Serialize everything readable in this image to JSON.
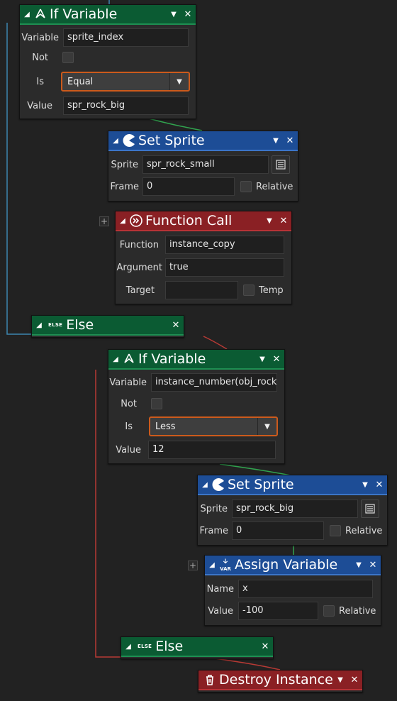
{
  "nodes": {
    "if_var_1": {
      "title": "If Variable",
      "variable_label": "Variable",
      "variable_value": "sprite_index",
      "not_label": "Not",
      "is_label": "Is",
      "is_value": "Equal",
      "value_label": "Value",
      "value_value": "spr_rock_big"
    },
    "set_sprite_1": {
      "title": "Set Sprite",
      "sprite_label": "Sprite",
      "sprite_value": "spr_rock_small",
      "frame_label": "Frame",
      "frame_value": "0",
      "relative_label": "Relative"
    },
    "function_call": {
      "title": "Function Call",
      "function_label": "Function",
      "function_value": "instance_copy",
      "argument_label": "Argument",
      "argument_value": "true",
      "target_label": "Target",
      "target_value": "",
      "temp_label": "Temp"
    },
    "else_1": {
      "tag": "ELSE",
      "title": "Else"
    },
    "if_var_2": {
      "title": "If Variable",
      "variable_label": "Variable",
      "variable_value": "instance_number(obj_rock)",
      "not_label": "Not",
      "is_label": "Is",
      "is_value": "Less",
      "value_label": "Value",
      "value_value": "12"
    },
    "set_sprite_2": {
      "title": "Set Sprite",
      "sprite_label": "Sprite",
      "sprite_value": "spr_rock_big",
      "frame_label": "Frame",
      "frame_value": "0",
      "relative_label": "Relative"
    },
    "assign_var": {
      "icon_text": "VAR",
      "title": "Assign Variable",
      "name_label": "Name",
      "name_value": "x",
      "value_label": "Value",
      "value_value": "-100",
      "relative_label": "Relative"
    },
    "else_2": {
      "tag": "ELSE",
      "title": "Else"
    },
    "destroy": {
      "title": "Destroy Instance"
    }
  },
  "glyphs": {
    "collapse": "◢",
    "dropdown": "▼",
    "close": "✕",
    "plus": "+"
  },
  "colors": {
    "green_header": "#0b5b33",
    "blue_header": "#1d4d96",
    "red_header": "#8a2024",
    "select_border": "#cc5a1c",
    "wire_blue": "#3d86b0",
    "wire_red": "#b83a35",
    "wire_green": "#31a44f"
  }
}
